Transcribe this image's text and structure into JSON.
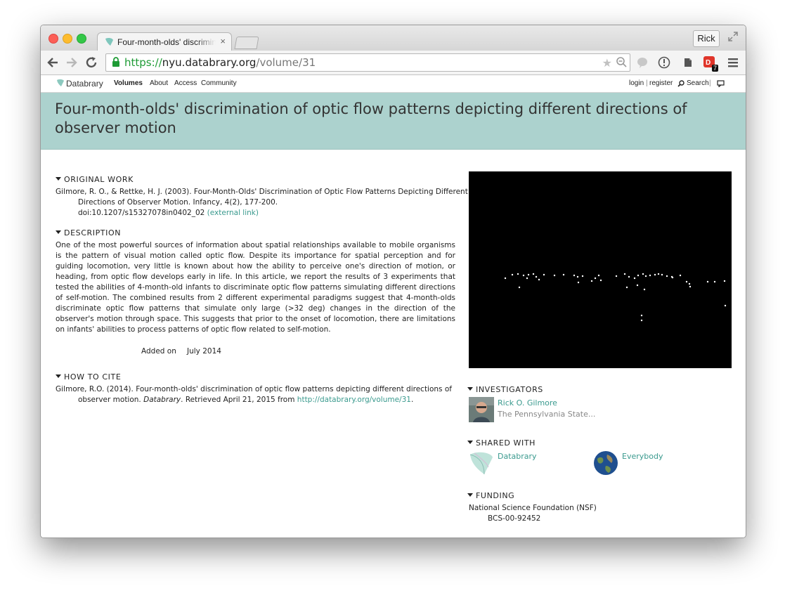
{
  "browser": {
    "tab_title": "Four-month-olds' discrimination of optic flow patterns depicting different directions of observer motion",
    "tab_close": "×",
    "profile_name": "Rick",
    "url_scheme": "https://",
    "url_host": "nyu.databrary.org",
    "url_path": "/volume/31",
    "extension_badge": "7",
    "icons": [
      "back-icon",
      "forward-icon",
      "reload-icon",
      "lock-icon",
      "star-icon",
      "zoom-icon",
      "menu-icon"
    ]
  },
  "site_nav": {
    "brand": "Databrary",
    "volumes": "Volumes",
    "about": "About",
    "access": "Access",
    "community": "Community",
    "login": "login",
    "separator": "|",
    "register": "register",
    "search": "Search",
    "search_sep": "|"
  },
  "volume": {
    "title": "Four-month-olds' discrimination of optic flow patterns depicting different directions of observer motion",
    "original_work": {
      "heading": "ORIGINAL WORK",
      "citation": "Gilmore, R. O., & Rettke, H. J. (2003). Four-Month-Olds' Discrimination of Optic Flow Patterns Depicting Different Directions of Observer Motion. Infancy, 4(2), 177-200.",
      "doi": "doi:10.1207/s15327078in0402_02",
      "external_link": "(external link)"
    },
    "description": {
      "heading": "DESCRIPTION",
      "text": "One of the most powerful sources of information about spatial relationships available to mobile organisms is the pattern of visual motion called optic flow. Despite its importance for spatial perception and for guiding locomotion, very little is known about how the ability to perceive one's direction of motion, or heading, from optic flow develops early in life. In this article, we report the results of 3 experiments that tested the abilities of 4-month-old infants to discriminate optic flow patterns simulating different directions of self-motion. The combined results from 2 different experimental paradigms suggest that 4-month-olds discriminate optic flow patterns that simulate only large (>32 deg) changes in the direction of the observer's motion through space. This suggests that prior to the onset of locomotion, there are limitations on infants' abilities to process patterns of optic flow related to self-motion.",
      "added_label": "Added on",
      "added_date": "July 2014"
    },
    "how_to_cite": {
      "heading": "HOW TO CITE",
      "prefix": "Gilmore, R.O. (2014). Four-month-olds' discrimination of optic flow patterns depicting different directions of observer motion. ",
      "journal": "Databrary",
      "middle": ". Retrieved April 21, 2015 from ",
      "link": "http://databrary.org/volume/31",
      "suffix": "."
    },
    "investigators": {
      "heading": "INVESTIGATORS",
      "name": "Rick O. Gilmore",
      "affiliation": "The Pennsylvania State..."
    },
    "shared_with": {
      "heading": "SHARED WITH",
      "items": [
        "Databrary",
        "Everybody"
      ]
    },
    "funding": {
      "heading": "FUNDING",
      "funder": "National Science Foundation (NSF)",
      "award": "BCS-00-92452"
    }
  },
  "colors": {
    "banner": "#acd2ce",
    "link": "#3a9a8e",
    "secure": "#1e9b35"
  }
}
